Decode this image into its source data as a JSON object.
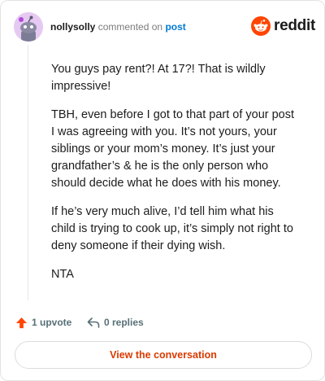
{
  "header": {
    "username": "nollysolly",
    "commented_on": "commented on",
    "post_link": "post",
    "brand": "reddit"
  },
  "comment": {
    "paragraphs": [
      "You guys pay rent?! At 17?! That is wildly impressive!",
      "TBH, even before I got to that part of your post I was agreeing with you. It’s not yours, your siblings or your mom’s money. It’s just your grandfather’s & he is the only person who should decide what he does with his money.",
      "If he’s very much alive, I’d tell him what his child is trying to cook up, it’s simply not right to deny someone if their dying wish.",
      "NTA"
    ]
  },
  "actions": {
    "upvote_label": "1 upvote",
    "replies_label": "0 replies"
  },
  "cta": {
    "label": "View the conversation"
  },
  "colors": {
    "brand_orange": "#ff4500",
    "link_blue": "#0079d3",
    "cta_text": "#d93a00"
  },
  "icons": {
    "avatar": "snoo-avatar-icon",
    "brand": "reddit-logo-icon",
    "upvote": "upvote-arrow-icon",
    "reply": "reply-arrow-icon"
  }
}
